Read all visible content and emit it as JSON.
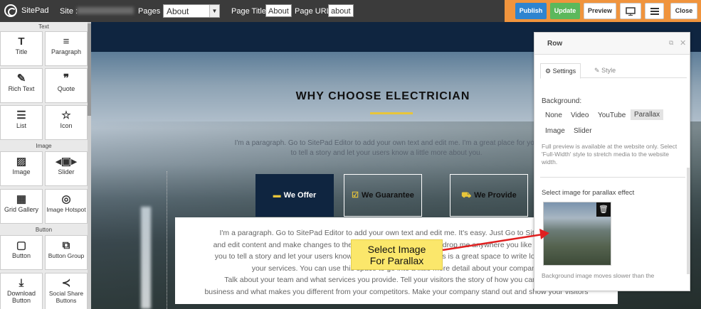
{
  "topbar": {
    "brand": "SitePad",
    "site_label": "Site :",
    "pages_label": "Pages :",
    "pages_value": "About",
    "page_title_label": "Page Title:",
    "page_title_value": "About",
    "page_url_label": "Page URL:",
    "page_url_value": "about",
    "publish": "Publish",
    "update": "Update",
    "preview": "Preview",
    "close": "Close",
    "publish_color": "#2e84d0",
    "update_color": "#5cb85c",
    "bar_color": "#f0943d"
  },
  "widgets": {
    "sections": {
      "text": "Text",
      "image": "Image",
      "button": "Button"
    },
    "items": [
      {
        "label": "Title",
        "icon": "title-icon"
      },
      {
        "label": "Paragraph",
        "icon": "paragraph-icon"
      },
      {
        "label": "Rich Text",
        "icon": "rich-text-icon"
      },
      {
        "label": "Quote",
        "icon": "quote-icon"
      },
      {
        "label": "List",
        "icon": "list-icon"
      },
      {
        "label": "Icon",
        "icon": "star-icon"
      },
      {
        "label": "Image",
        "icon": "image-icon"
      },
      {
        "label": "Slider",
        "icon": "slider-icon"
      },
      {
        "label": "Grid Gallery",
        "icon": "grid-gallery-icon"
      },
      {
        "label": "Image Hotspot",
        "icon": "hotspot-icon"
      },
      {
        "label": "Button",
        "icon": "button-icon"
      },
      {
        "label": "Button Group",
        "icon": "button-group-icon"
      },
      {
        "label": "Download Button",
        "icon": "download-icon"
      },
      {
        "label": "Social Share Buttons",
        "icon": "share-icon"
      }
    ]
  },
  "canvas": {
    "heading": "WHY CHOOSE ELECTRICIAN",
    "intro": "I'm a paragraph. Go to SitePad Editor to add your own text and edit me. I'm a great place for you to tell a story and let your users know a little more about you.",
    "tabs": [
      {
        "label": "We Offer",
        "icon": "credit-card-icon"
      },
      {
        "label": "We Guarantee",
        "icon": "check-square-icon"
      },
      {
        "label": "We Provide",
        "icon": "truck-icon"
      }
    ],
    "content_lines": [
      "I'm a paragraph. Go to SitePad Editor to add your own text and edit me. It's easy. Just Go to SitePad Editor",
      "and edit content and make changes to the font. Feel free to drag and drop me anywhere you like on your page.",
      "you to tell a story and let your users know a little more about you. This is a great space to write long text about",
      "your services. You can use this space to go into a little more detail about your company.",
      "Talk about your team and what services you provide. Tell your visitors the story of how you came up with",
      "business and what makes you different from your competitors. Make your company stand out and show your visitors"
    ]
  },
  "callout": {
    "line1": "Select Image",
    "line2": "For Parallax",
    "arrow_color": "#e02020"
  },
  "panel": {
    "title": "Row",
    "tab_settings": "Settings",
    "tab_style": "Style",
    "background_label": "Background:",
    "options": [
      "None",
      "Video",
      "YouTube",
      "Parallax",
      "Image",
      "Slider"
    ],
    "selected_option": "Parallax",
    "note": "Full preview is available at the website only. Select 'Full-Width' style to stretch media to the website width.",
    "select_label": "Select image for parallax effect",
    "footer": "Background image moves slower than the"
  }
}
